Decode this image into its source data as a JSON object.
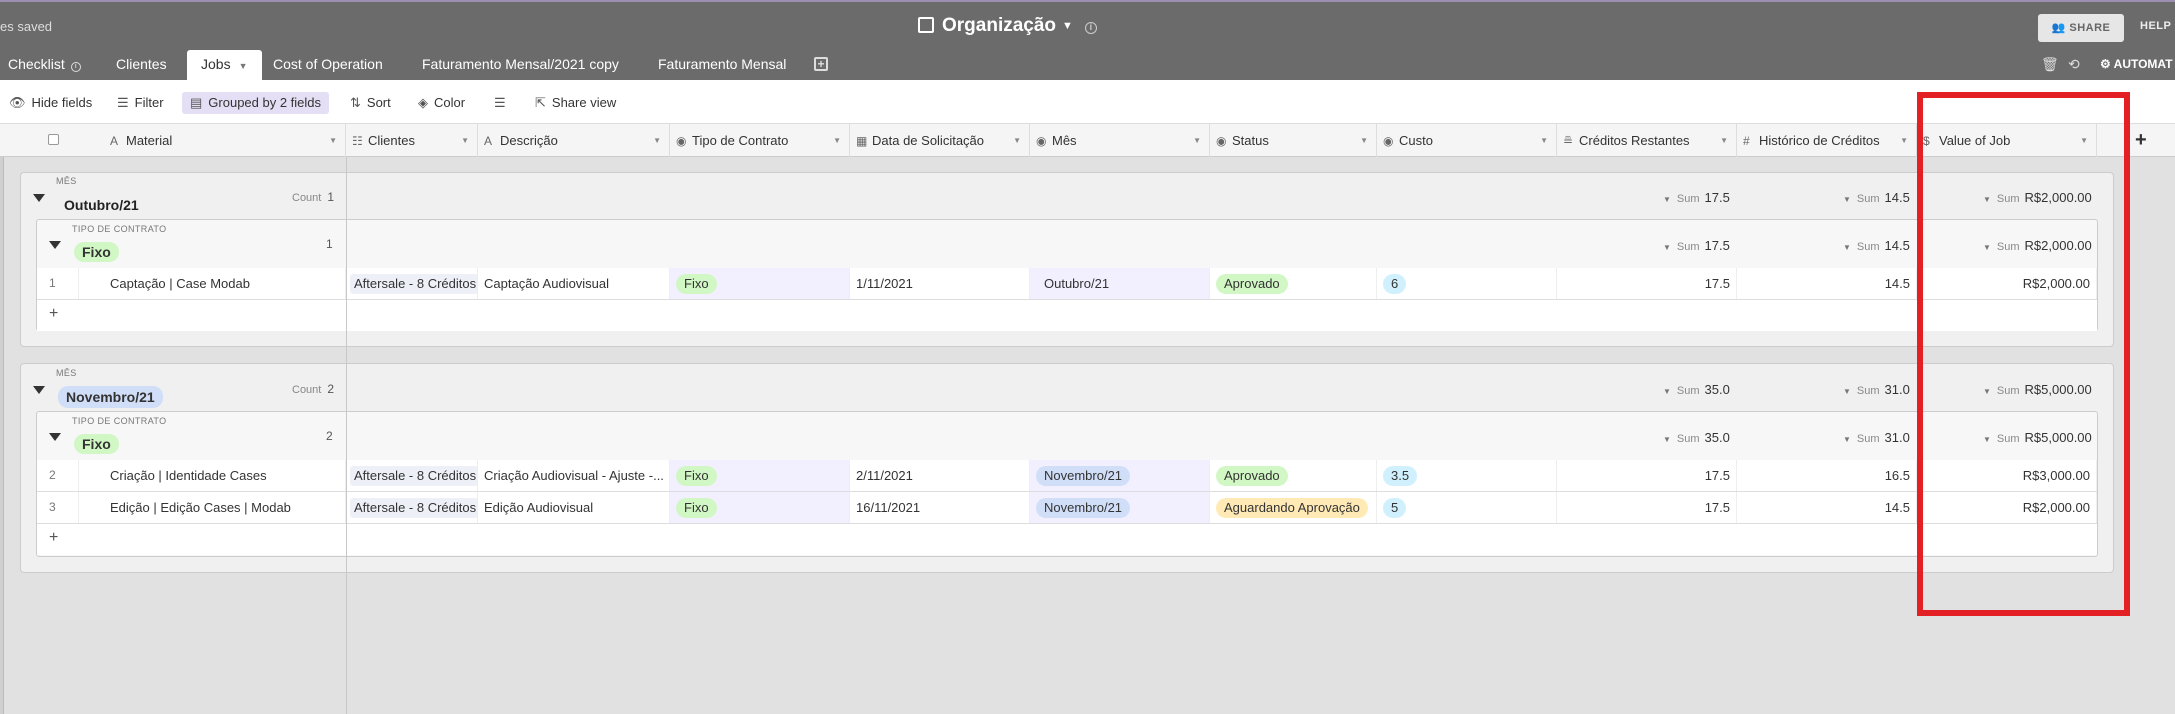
{
  "topbar": {
    "save_status": "es saved",
    "base_title": "Organização",
    "share_label": "SHARE",
    "help_label": "HELP"
  },
  "tabs": [
    {
      "label": "Checklist"
    },
    {
      "label": "Clientes"
    },
    {
      "label": "Jobs"
    },
    {
      "label": "Cost of Operation"
    },
    {
      "label": "Faturamento Mensal/2021 copy"
    },
    {
      "label": "Faturamento Mensal"
    }
  ],
  "automation_label": "AUTOMAT",
  "toolbar": {
    "hide_fields": "Hide fields",
    "filter": "Filter",
    "grouped": "Grouped by 2 fields",
    "sort": "Sort",
    "color": "Color",
    "share_view": "Share view"
  },
  "columns": [
    "Material",
    "Clientes",
    "Descrição",
    "Tipo de Contrato",
    "Data de Solicitação",
    "Mês",
    "Status",
    "Custo",
    "Créditos Restantes",
    "Histórico de Créditos",
    "Value of Job"
  ],
  "groups": [
    {
      "label": "MÊS",
      "value": "Outubro/21",
      "count_label": "Count",
      "count": "1",
      "sums": {
        "creditos": "17.5",
        "historico": "14.5",
        "value": "R$2,000.00"
      },
      "subgroup": {
        "label": "TIPO DE CONTRATO",
        "value": "Fixo",
        "count": "1",
        "sums": {
          "creditos": "17.5",
          "historico": "14.5",
          "value": "R$2,000.00"
        }
      },
      "rows": [
        {
          "n": "1",
          "material": "Captação | Case Modab",
          "clientes": "Aftersale - 8 Créditos",
          "descricao": "Captação Audiovisual",
          "tipo": "Fixo",
          "data": "1/11/2021",
          "mes": "Outubro/21",
          "status": "Aprovado",
          "custo": "6",
          "creditos": "17.5",
          "historico": "14.5",
          "value": "R$2,000.00"
        }
      ]
    },
    {
      "label": "MÊS",
      "value": "Novembro/21",
      "count_label": "Count",
      "count": "2",
      "sums": {
        "creditos": "35.0",
        "historico": "31.0",
        "value": "R$5,000.00"
      },
      "subgroup": {
        "label": "TIPO DE CONTRATO",
        "value": "Fixo",
        "count": "2",
        "sums": {
          "creditos": "35.0",
          "historico": "31.0",
          "value": "R$5,000.00"
        }
      },
      "rows": [
        {
          "n": "2",
          "material": "Criação | Identidade Cases",
          "clientes": "Aftersale - 8 Créditos",
          "descricao": "Criação Audiovisual - Ajuste -...",
          "tipo": "Fixo",
          "data": "2/11/2021",
          "mes": "Novembro/21",
          "status": "Aprovado",
          "custo": "3.5",
          "creditos": "17.5",
          "historico": "16.5",
          "value": "R$3,000.00"
        },
        {
          "n": "3",
          "material": "Edição | Edição Cases | Modab",
          "clientes": "Aftersale - 8 Créditos",
          "descricao": "Edição Audiovisual",
          "tipo": "Fixo",
          "data": "16/11/2021",
          "mes": "Novembro/21",
          "status": "Aguardando Aprovação",
          "custo": "5",
          "creditos": "17.5",
          "historico": "14.5",
          "value": "R$2,000.00"
        }
      ]
    }
  ],
  "sum_label": "Sum",
  "add_row_symbol": "+",
  "colors": {
    "highlight": "#e32125",
    "fixo_pill": "#d1f7c4",
    "aprovado_pill": "#d1f7c4",
    "aguardando_pill": "#ffeab6",
    "mes_pill": "#d0def8",
    "custo_pill": "#d0f0fd",
    "tipo_cell_bg": "#f2f0ff"
  }
}
